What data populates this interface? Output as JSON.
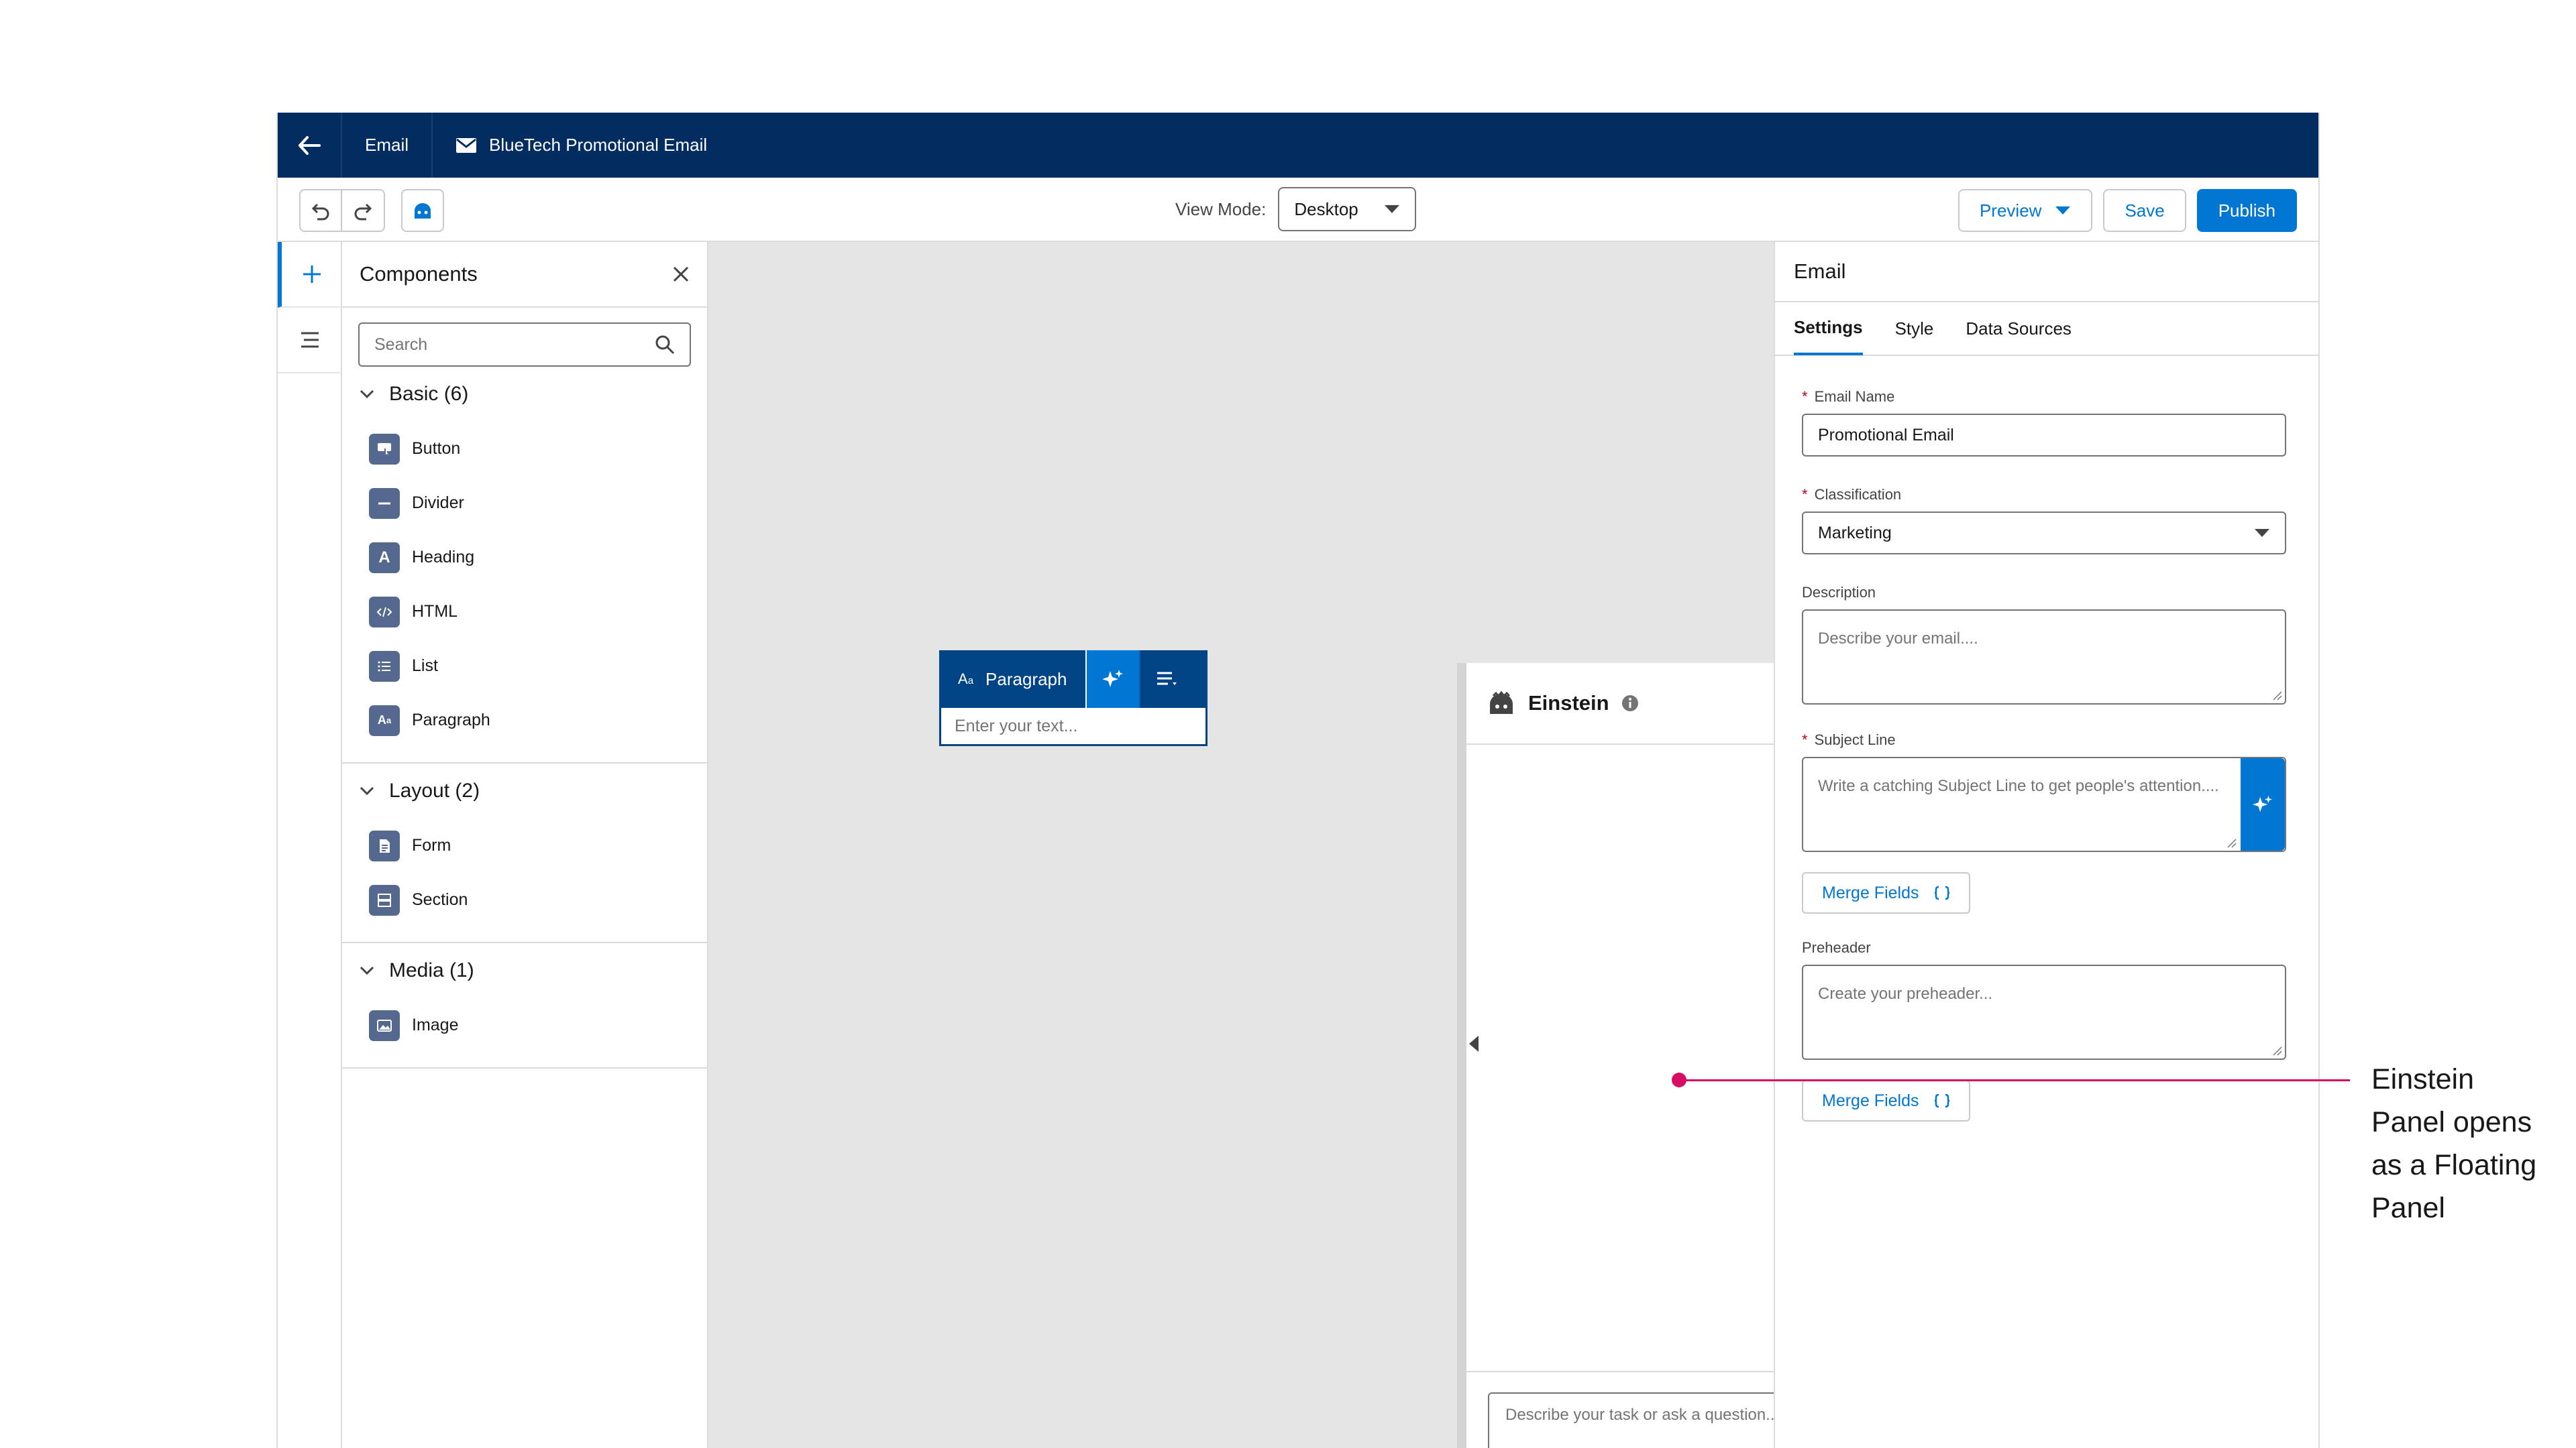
{
  "topbar": {
    "crumb": "Email",
    "title": "BlueTech Promotional Email"
  },
  "toolbar": {
    "view_mode_label": "View Mode:",
    "view_mode_value": "Desktop",
    "preview_label": "Preview",
    "save_label": "Save",
    "publish_label": "Publish"
  },
  "components": {
    "title": "Components",
    "search_placeholder": "Search",
    "sections": [
      {
        "title": "Basic (6)",
        "items": [
          {
            "label": "Button",
            "icon": "button-icon"
          },
          {
            "label": "Divider",
            "icon": "divider-icon"
          },
          {
            "label": "Heading",
            "icon": "heading-icon"
          },
          {
            "label": "HTML",
            "icon": "html-icon"
          },
          {
            "label": "List",
            "icon": "list-icon"
          },
          {
            "label": "Paragraph",
            "icon": "paragraph-icon"
          }
        ]
      },
      {
        "title": "Layout (2)",
        "items": [
          {
            "label": "Form",
            "icon": "form-icon"
          },
          {
            "label": "Section",
            "icon": "section-icon"
          }
        ]
      },
      {
        "title": "Media (1)",
        "items": [
          {
            "label": "Image",
            "icon": "image-icon"
          }
        ]
      }
    ]
  },
  "canvas": {
    "paragraph_label": "Paragraph",
    "paragraph_placeholder": "Enter your text..."
  },
  "einstein": {
    "title": "Einstein",
    "prompt_placeholder": "Describe your task or ask a question..."
  },
  "properties": {
    "title": "Email",
    "tabs": [
      "Settings",
      "Style",
      "Data Sources"
    ],
    "email_name_label": "Email Name",
    "email_name_value": "Promotional Email",
    "classification_label": "Classification",
    "classification_value": "Marketing",
    "description_label": "Description",
    "description_placeholder": "Describe your email....",
    "subject_label": "Subject Line",
    "subject_placeholder": "Write a catching Subject Line to get people's attention....",
    "merge_fields_label": "Merge Fields",
    "preheader_label": "Preheader",
    "preheader_placeholder": "Create your preheader..."
  },
  "annotation": {
    "text": "Einstein Panel opens as a Floating Panel"
  },
  "colors": {
    "navy": "#032d60",
    "brand": "#0176d3",
    "annotation": "#d60d62"
  }
}
